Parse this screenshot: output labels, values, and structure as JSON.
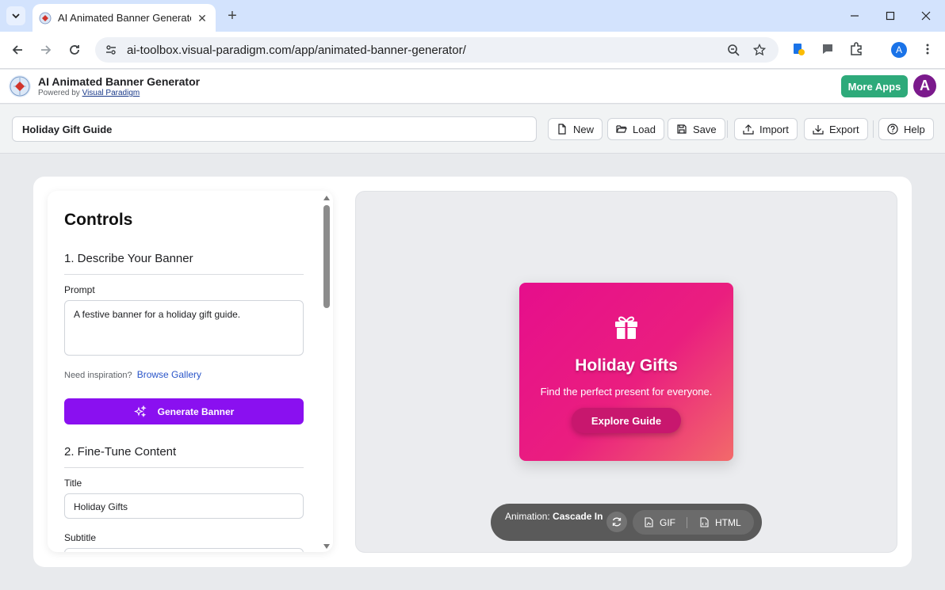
{
  "browser": {
    "tab_title": "AI Animated Banner Generator",
    "url": "ai-toolbox.visual-paradigm.com/app/animated-banner-generator/",
    "profile_initial": "A"
  },
  "app": {
    "title": "AI Animated Banner Generator",
    "powered_by": "Powered by",
    "powered_link": "Visual Paradigm",
    "more_apps": "More Apps",
    "user_initial": "A"
  },
  "toolbar": {
    "project_title": "Holiday Gift Guide",
    "buttons": {
      "new": "New",
      "load": "Load",
      "save": "Save",
      "import": "Import",
      "export": "Export",
      "help": "Help"
    }
  },
  "controls": {
    "heading": "Controls",
    "section1": "1. Describe Your Banner",
    "prompt_label": "Prompt",
    "prompt_value": "A festive banner for a holiday gift guide.",
    "inspiration_text": "Need inspiration?",
    "browse_gallery": "Browse Gallery",
    "generate_button": "Generate Banner",
    "section2": "2. Fine-Tune Content",
    "title_label": "Title",
    "title_value": "Holiday Gifts",
    "subtitle_label": "Subtitle"
  },
  "banner": {
    "title": "Holiday Gifts",
    "subtitle": "Find the perfect present for everyone.",
    "cta": "Explore Guide",
    "gradient_start": "#e60e8c",
    "gradient_end": "#f26a6a"
  },
  "animation_bar": {
    "label": "Animation:",
    "name": "Cascade In",
    "gif": "GIF",
    "html": "HTML"
  },
  "colors": {
    "accent_purple": "#8a10f0",
    "more_apps_green": "#2eaa7a"
  }
}
